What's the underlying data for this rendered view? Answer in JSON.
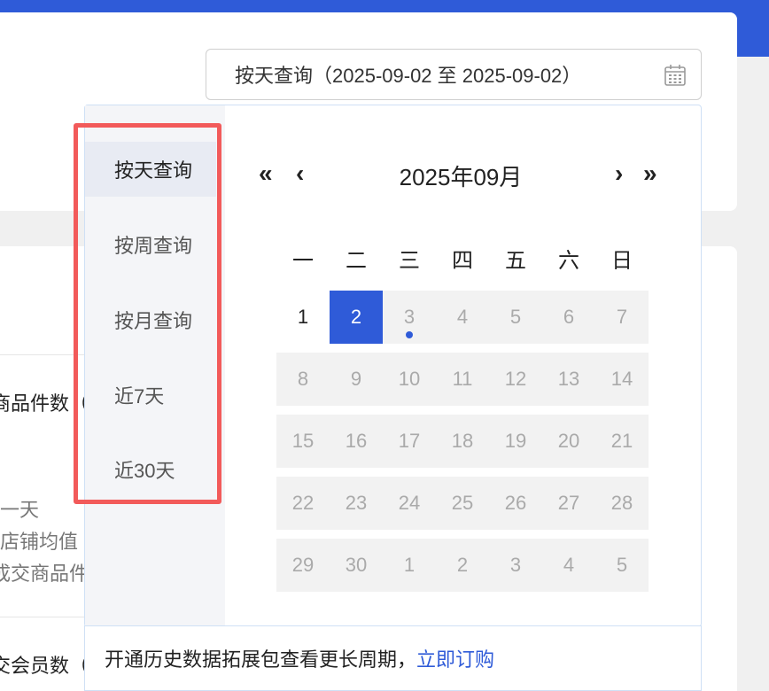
{
  "date_input": {
    "value": "按天查询（2025-09-02 至 2025-09-02）"
  },
  "background": {
    "lines": [
      "商品件数（",
      "一天",
      "店铺均值",
      "成交商品件",
      "交会员数（"
    ]
  },
  "sidebar": {
    "items": [
      {
        "label": "按天查询",
        "active": true
      },
      {
        "label": "按周查询"
      },
      {
        "label": "按月查询"
      },
      {
        "label": "近7天"
      },
      {
        "label": "近30天"
      }
    ]
  },
  "calendar": {
    "prev_year": "«",
    "prev_month": "‹",
    "title": "2025年09月",
    "next_month": "›",
    "next_year": "»",
    "weekdays": [
      "一",
      "二",
      "三",
      "四",
      "五",
      "六",
      "日"
    ],
    "weeks": [
      [
        "1",
        "2",
        "3",
        "4",
        "5",
        "6",
        "7"
      ],
      [
        "8",
        "9",
        "10",
        "11",
        "12",
        "13",
        "14"
      ],
      [
        "15",
        "16",
        "17",
        "18",
        "19",
        "20",
        "21"
      ],
      [
        "22",
        "23",
        "24",
        "25",
        "26",
        "27",
        "28"
      ],
      [
        "29",
        "30",
        "1",
        "2",
        "3",
        "4",
        "5"
      ]
    ],
    "selected_day": "2",
    "today_dot_day": "3"
  },
  "footer": {
    "text": "开通历史数据拓展包查看更长周期，",
    "link": "立即订购"
  },
  "colors": {
    "accent": "#2f5bd8",
    "highlight": "#f25a5a"
  }
}
